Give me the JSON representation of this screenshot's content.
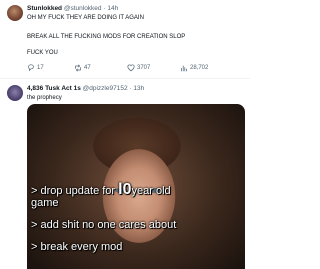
{
  "tweets": [
    {
      "display_name": "Stunlokked",
      "handle": "@stunlokked",
      "time": "14h",
      "lines": [
        "OH MY FUCK THEY ARE DOING IT AGAIN",
        "BREAK ALL THE FUCKING MODS FOR CREATION SLOP",
        "FUCK YOU"
      ],
      "replies": "17",
      "reposts": "47",
      "likes": "3707",
      "views": "28,702"
    },
    {
      "display_name": "4,836 Tusk Act 1s",
      "handle": "@dpizzle97152",
      "time": "13h",
      "text": "the prophecy",
      "meme_lines": {
        "l1_pre": "> drop update for ",
        "l1_big": "l0",
        "l1_post": "year old",
        "l2": "game",
        "l3": "> add shit no one cares about",
        "l4": "> break every mod"
      }
    }
  ],
  "icons": {
    "reply": "reply-icon",
    "repost": "repost-icon",
    "like": "heart-icon",
    "views": "views-icon"
  }
}
